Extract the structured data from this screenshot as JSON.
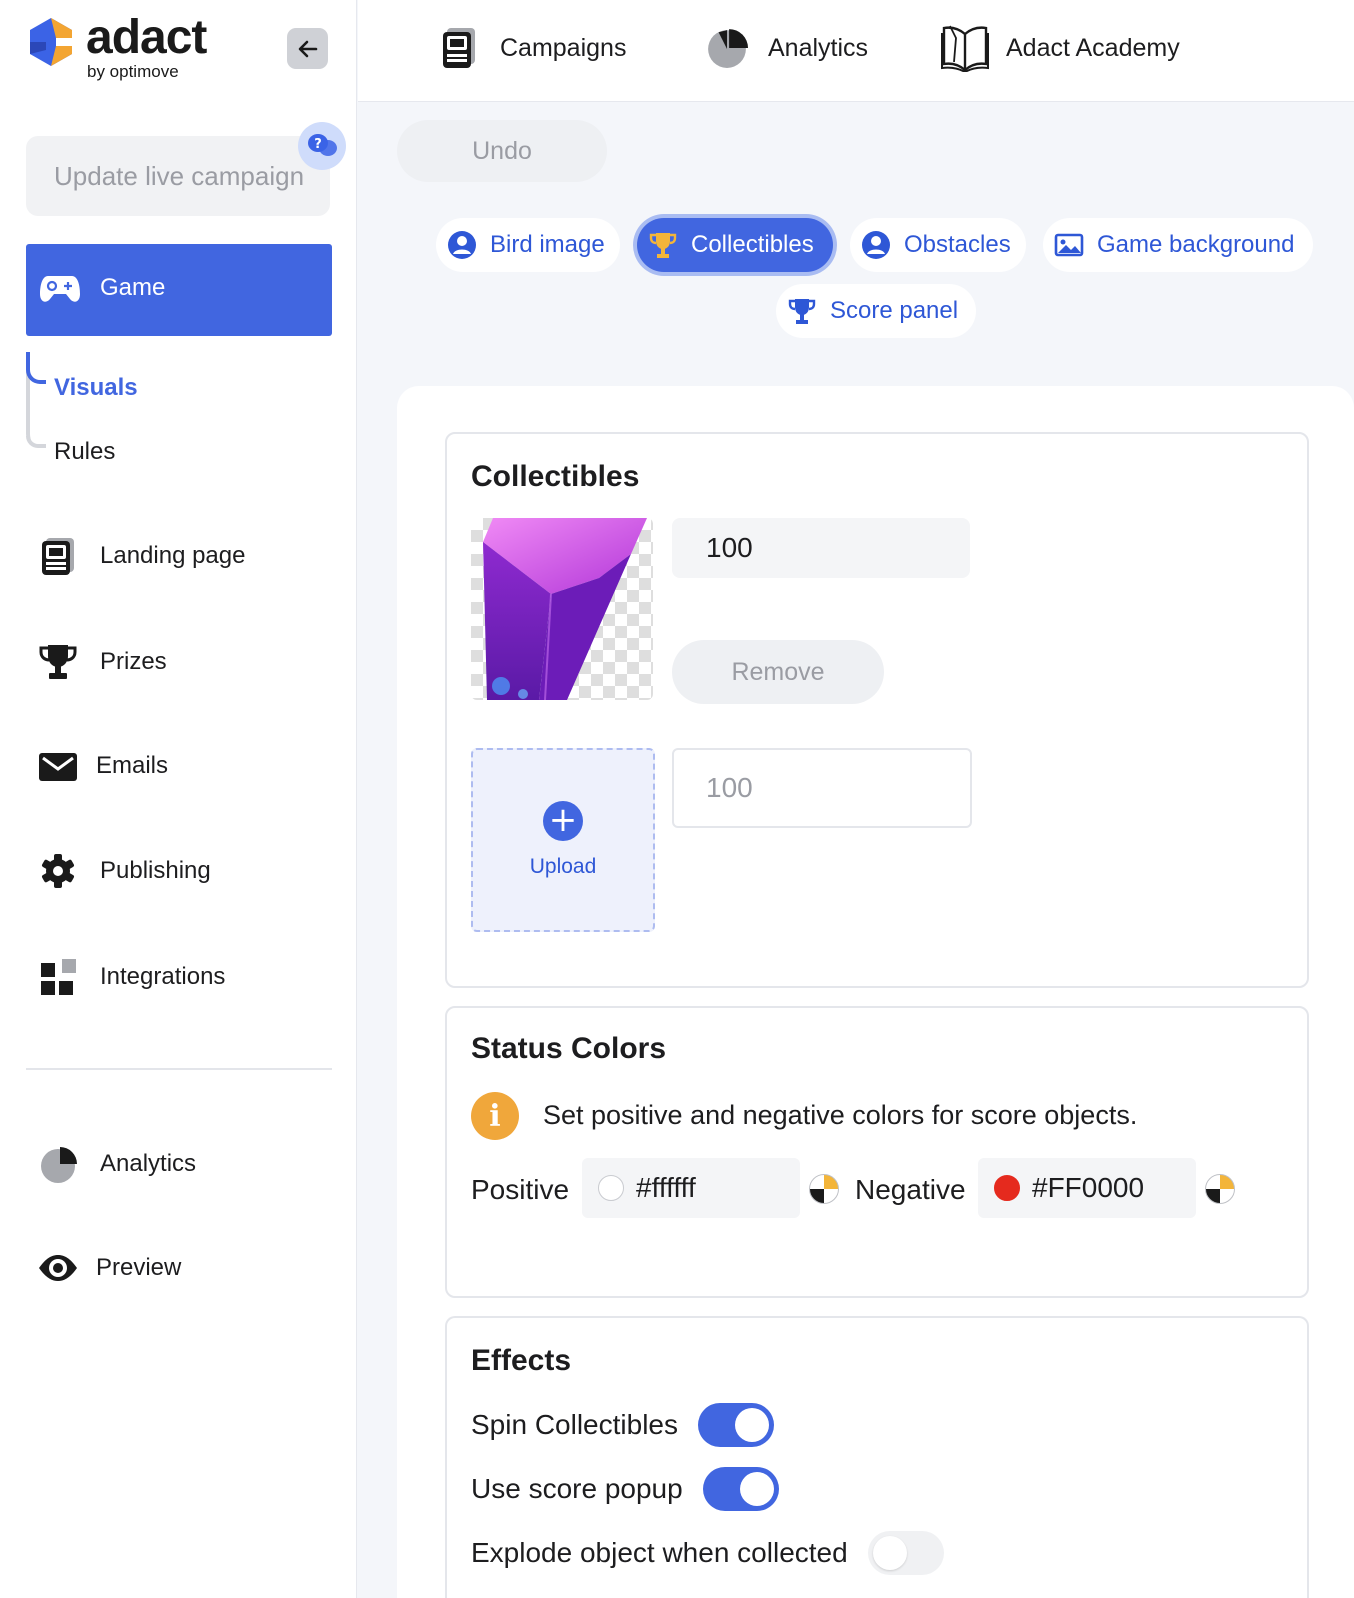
{
  "brand": {
    "name": "adact",
    "sub": "by optimove"
  },
  "sidebar": {
    "update_live": "Update live campaign",
    "game": "Game",
    "sub": {
      "visuals": "Visuals",
      "rules": "Rules"
    },
    "items": [
      {
        "label": "Landing page",
        "icon": "landing-page-icon"
      },
      {
        "label": "Prizes",
        "icon": "trophy-icon"
      },
      {
        "label": "Emails",
        "icon": "envelope-icon"
      },
      {
        "label": "Publishing",
        "icon": "gear-icon"
      },
      {
        "label": "Integrations",
        "icon": "integrations-icon"
      }
    ],
    "bottom_items": [
      {
        "label": "Analytics",
        "icon": "pie-chart-icon"
      },
      {
        "label": "Preview",
        "icon": "eye-icon"
      }
    ]
  },
  "topnav": {
    "campaigns": "Campaigns",
    "analytics": "Analytics",
    "academy": "Adact Academy"
  },
  "toolbar": {
    "undo": "Undo"
  },
  "tabs": {
    "bird_image": "Bird image",
    "collectibles": "Collectibles",
    "obstacles": "Obstacles",
    "game_background": "Game background",
    "score_panel": "Score panel",
    "active": "collectibles"
  },
  "collectibles": {
    "title": "Collectibles",
    "item_value": "100",
    "remove": "Remove",
    "upload": "Upload",
    "new_value_placeholder": "100"
  },
  "status_colors": {
    "title": "Status Colors",
    "info": "Set positive and negative colors for score objects.",
    "positive_label": "Positive",
    "positive_value": "#ffffff",
    "negative_label": "Negative",
    "negative_value": "#FF0000"
  },
  "effects": {
    "title": "Effects",
    "spin_label": "Spin Collectibles",
    "spin_on": true,
    "popup_label": "Use score popup",
    "popup_on": true,
    "explode_label": "Explode object when collected",
    "explode_on": false
  },
  "colors": {
    "accent": "#4166e0",
    "accent_text": "#2e57d6",
    "info": "#f0a73b",
    "negative": "#FF0000"
  }
}
